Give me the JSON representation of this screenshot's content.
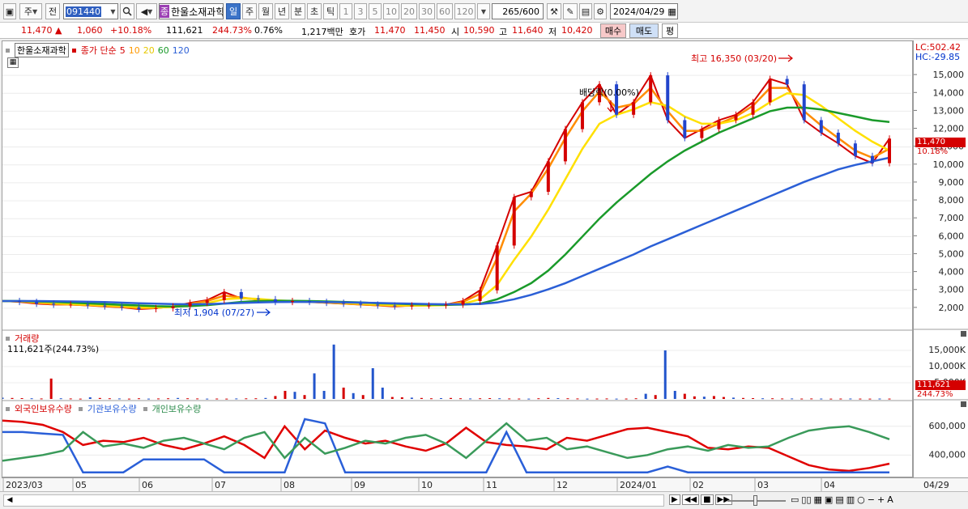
{
  "toolbar": {
    "market": "주",
    "prev": "전",
    "code": "091440",
    "name_tag": "종",
    "name": "한울소재과학",
    "periods": [
      "일",
      "주",
      "월",
      "년",
      "분",
      "초",
      "틱"
    ],
    "active_period": 0,
    "intervals": [
      "1",
      "3",
      "5",
      "10",
      "20",
      "30",
      "60",
      "120"
    ],
    "count": "265",
    "count_max": "/600",
    "date": "2024/04/29"
  },
  "quote": {
    "price": "11,470",
    "up_mark": "▲",
    "change": "1,060",
    "change_pct": "+10.18%",
    "volume": "111,621",
    "volume_ratio": "244.73%",
    "turnover": "0.76%",
    "amount": "1,217백만",
    "hoga_label": "호가",
    "ask": "11,470",
    "bid": "11,450",
    "open_label": "시",
    "open": "10,590",
    "high_label": "고",
    "high": "11,640",
    "low_label": "저",
    "low": "10,420",
    "buy_btn": "매수",
    "sell_btn": "매도",
    "eval_btn": "평"
  },
  "price_panel": {
    "stock_label": "한울소재과학",
    "ma_label": "종가 단순",
    "ma_periods": [
      "5",
      "10",
      "20",
      "60",
      "120"
    ],
    "lc": "LC:502.42",
    "hc": "HC:-29.85",
    "current_tag": "11,470",
    "current_pct": "10.18%",
    "high_annotation": "최고 16,350 (03/20)",
    "low_annotation": "최저 1,904 (07/27)",
    "dividend_annotation": "배당락(0.00%)"
  },
  "volume_panel": {
    "title": "거래량",
    "summary": "111,621주(244.73%)",
    "tag": "111,621",
    "tag_pct": "244.73%"
  },
  "holdings_panel": {
    "labels": [
      "외국인보유수량",
      "기관보유수량",
      "개인보유수량"
    ]
  },
  "chart_data": [
    {
      "type": "line",
      "title": "",
      "y_ticks": [
        2000,
        3000,
        4000,
        5000,
        6000,
        7000,
        8000,
        9000,
        10000,
        11000,
        12000,
        13000,
        14000,
        15000
      ],
      "y_tick_labels": [
        "2,000",
        "3,000",
        "4,000",
        "5,000",
        "6,000",
        "7,000",
        "8,000",
        "9,000",
        "10,000",
        "11,000",
        "12,000",
        "13,000",
        "14,000",
        "15,000"
      ],
      "ylim": [
        1000,
        16000
      ],
      "x_labels": [
        "2023/03",
        "05",
        "06",
        "07",
        "08",
        "09",
        "10",
        "11",
        "12",
        "2024/01",
        "02",
        "03",
        "04",
        "04/29"
      ],
      "series": [
        {
          "name": "종가",
          "color": "#d40000",
          "values": [
            2400,
            2350,
            2250,
            2200,
            2200,
            2150,
            2100,
            2050,
            1950,
            2000,
            2100,
            2300,
            2450,
            2900,
            2550,
            2500,
            2350,
            2400,
            2350,
            2300,
            2250,
            2200,
            2150,
            2100,
            2150,
            2150,
            2200,
            2400,
            3000,
            5500,
            8200,
            8500,
            10200,
            12000,
            13500,
            14500,
            12800,
            13500,
            15000,
            12500,
            11500,
            12000,
            12500,
            12800,
            13500,
            14800,
            14500,
            12500,
            11800,
            11200,
            10500,
            10100,
            11470
          ]
        },
        {
          "name": "5",
          "color": "#ff8c00",
          "values": [
            2400,
            2380,
            2300,
            2230,
            2200,
            2170,
            2120,
            2070,
            2000,
            2020,
            2090,
            2250,
            2400,
            2700,
            2600,
            2480,
            2380,
            2380,
            2350,
            2310,
            2260,
            2210,
            2170,
            2130,
            2140,
            2150,
            2190,
            2350,
            2800,
            4800,
            7400,
            8400,
            9800,
            11500,
            13000,
            14100,
            13200,
            13400,
            14300,
            13000,
            11900,
            11900,
            12300,
            12700,
            13300,
            14300,
            14300,
            13000,
            12200,
            11500,
            10800,
            10400,
            10900
          ]
        },
        {
          "name": "20",
          "color": "#ffe000",
          "values": [
            2400,
            2390,
            2350,
            2290,
            2240,
            2200,
            2160,
            2120,
            2060,
            2040,
            2060,
            2150,
            2280,
            2500,
            2560,
            2520,
            2440,
            2400,
            2380,
            2350,
            2300,
            2250,
            2210,
            2170,
            2150,
            2150,
            2170,
            2250,
            2500,
            3300,
            4700,
            6000,
            7500,
            9200,
            10900,
            12300,
            12800,
            13100,
            13500,
            13300,
            12700,
            12300,
            12300,
            12500,
            12900,
            13500,
            14000,
            13900,
            13300,
            12600,
            11900,
            11300,
            10800
          ]
        },
        {
          "name": "60",
          "color": "#1a9a2a",
          "values": [
            2400,
            2400,
            2380,
            2350,
            2310,
            2270,
            2230,
            2190,
            2150,
            2110,
            2100,
            2120,
            2170,
            2260,
            2350,
            2400,
            2420,
            2410,
            2400,
            2380,
            2350,
            2320,
            2280,
            2250,
            2220,
            2200,
            2190,
            2200,
            2250,
            2500,
            2900,
            3400,
            4100,
            5000,
            6000,
            7000,
            7900,
            8700,
            9500,
            10200,
            10800,
            11300,
            11800,
            12200,
            12600,
            13000,
            13200,
            13200,
            13100,
            12900,
            12700,
            12500,
            12400
          ]
        },
        {
          "name": "120",
          "color": "#2b5fd6",
          "values": [
            2400,
            2400,
            2400,
            2390,
            2380,
            2360,
            2340,
            2310,
            2280,
            2250,
            2230,
            2220,
            2230,
            2260,
            2290,
            2320,
            2340,
            2350,
            2350,
            2340,
            2330,
            2310,
            2290,
            2270,
            2250,
            2230,
            2220,
            2220,
            2230,
            2320,
            2500,
            2750,
            3050,
            3400,
            3800,
            4200,
            4600,
            5000,
            5450,
            5850,
            6250,
            6650,
            7050,
            7450,
            7850,
            8250,
            8650,
            9050,
            9400,
            9750,
            10000,
            10200,
            10400
          ]
        }
      ]
    },
    {
      "type": "bar",
      "title": "거래량",
      "y_tick_labels": [
        "5,000K",
        "10,000K",
        "15,000K"
      ],
      "y_ticks": [
        5000,
        10000,
        15000
      ],
      "ylim": [
        0,
        18000
      ],
      "values": [
        400,
        300,
        250,
        200,
        150,
        6300,
        200,
        150,
        100,
        500,
        300,
        200,
        150,
        100,
        200,
        100,
        150,
        200,
        300,
        200,
        150,
        100,
        120,
        100,
        150,
        180,
        200,
        300,
        900,
        2500,
        2200,
        1200,
        7900,
        2500,
        16800,
        3500,
        1800,
        1200,
        9500,
        3500,
        600,
        500,
        400,
        300,
        200,
        250,
        300,
        200,
        150,
        200,
        250,
        200,
        150,
        120,
        100,
        200,
        300,
        250,
        200,
        150,
        100,
        120,
        150,
        100,
        120,
        200,
        1600,
        1200,
        15000,
        2500,
        1600,
        800,
        700,
        900,
        600,
        400,
        300,
        250,
        200,
        200,
        150,
        150,
        120,
        150,
        120,
        100,
        120,
        130,
        110,
        100,
        120,
        110
      ]
    },
    {
      "type": "line",
      "title": "외국인/기관/개인 보유수량",
      "y_tick_labels": [
        "400,000",
        "600,000"
      ],
      "y_ticks": [
        400000,
        600000
      ],
      "ylim": [
        250000,
        700000
      ],
      "series": [
        {
          "name": "외국인보유수량",
          "color": "#e00000",
          "values": [
            640000,
            630000,
            610000,
            560000,
            470000,
            500000,
            490000,
            520000,
            470000,
            440000,
            480000,
            530000,
            470000,
            380000,
            600000,
            440000,
            570000,
            520000,
            480000,
            500000,
            460000,
            430000,
            480000,
            590000,
            490000,
            470000,
            460000,
            440000,
            520000,
            500000,
            540000,
            580000,
            590000,
            560000,
            530000,
            450000,
            440000,
            460000,
            450000,
            390000,
            330000,
            300000,
            290000,
            310000,
            340000
          ]
        },
        {
          "name": "기관보유수량",
          "color": "#2a5fd8",
          "values": [
            560000,
            560000,
            550000,
            540000,
            280000,
            280000,
            280000,
            370000,
            370000,
            370000,
            370000,
            280000,
            280000,
            280000,
            280000,
            650000,
            620000,
            280000,
            280000,
            280000,
            280000,
            280000,
            280000,
            280000,
            280000,
            560000,
            280000,
            280000,
            280000,
            280000,
            280000,
            280000,
            280000,
            320000,
            280000,
            280000,
            280000,
            280000,
            280000,
            280000,
            280000,
            280000,
            280000,
            280000,
            280000
          ]
        },
        {
          "name": "개인보유수량",
          "color": "#3a9a5a",
          "values": [
            360000,
            380000,
            400000,
            430000,
            560000,
            460000,
            480000,
            450000,
            500000,
            520000,
            480000,
            440000,
            520000,
            560000,
            380000,
            520000,
            410000,
            450000,
            500000,
            480000,
            520000,
            540000,
            480000,
            380000,
            500000,
            620000,
            500000,
            520000,
            440000,
            460000,
            420000,
            380000,
            400000,
            440000,
            460000,
            430000,
            470000,
            450000,
            460000,
            520000,
            570000,
            590000,
            600000,
            560000,
            510000
          ]
        }
      ]
    }
  ]
}
